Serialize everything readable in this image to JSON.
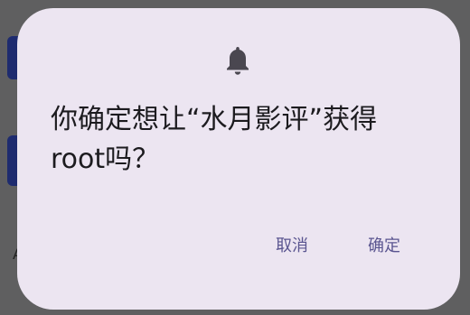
{
  "dialog": {
    "icon": "bell-icon",
    "title": "你确定想让“水月影评”获得root吗？",
    "cancel_label": "取消",
    "confirm_label": "确定"
  },
  "background": {
    "partial_text": "A"
  },
  "colors": {
    "scrim": "#5f5f60",
    "dialog_surface": "#ece5f1",
    "title_text": "#1c1b1f",
    "button_text": "#5a5590",
    "icon": "#4a4750"
  }
}
